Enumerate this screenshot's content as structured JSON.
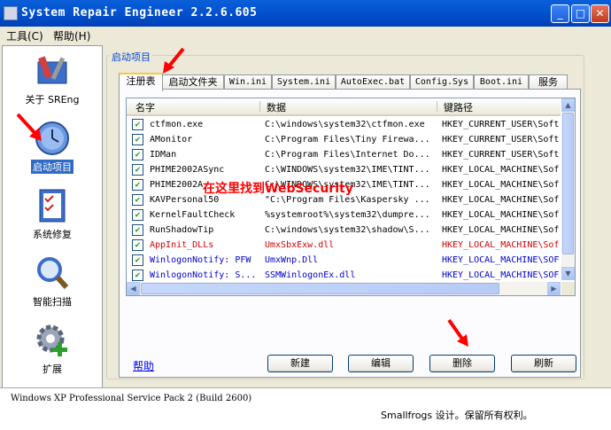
{
  "window": {
    "title": "System Repair Engineer 2.2.6.605",
    "minimize": "_",
    "maximize": "□",
    "close": "✕"
  },
  "menu": [
    "工具(C)",
    "帮助(H)"
  ],
  "sidebar": [
    {
      "label": "关于 SREng",
      "icon": "toolbox-icon",
      "selected": false
    },
    {
      "label": "启动项目",
      "icon": "clock-icon",
      "selected": true
    },
    {
      "label": "系统修复",
      "icon": "checklist-icon",
      "selected": false
    },
    {
      "label": "智能扫描",
      "icon": "magnifier-icon",
      "selected": false
    },
    {
      "label": "扩展",
      "icon": "gear-plus-icon",
      "selected": false
    }
  ],
  "group_title": "启动项目",
  "tabs": [
    "注册表",
    "启动文件夹",
    "Win.ini",
    "System.ini",
    "AutoExec.bat",
    "Config.Sys",
    "Boot.ini",
    "服务"
  ],
  "columns": [
    "名字",
    "数据",
    "键路径"
  ],
  "rows": [
    {
      "name": "ctfmon.exe",
      "data": "C:\\windows\\system32\\ctfmon.exe",
      "key": "HKEY_CURRENT_USER\\Soft",
      "color": "black"
    },
    {
      "name": "AMonitor",
      "data": "C:\\Program Files\\Tiny Firewa...",
      "key": "HKEY_CURRENT_USER\\Soft",
      "color": "black"
    },
    {
      "name": "IDMan",
      "data": "C:\\Program Files\\Internet Do...",
      "key": "HKEY_CURRENT_USER\\Soft",
      "color": "black"
    },
    {
      "name": "PHIME2002ASync",
      "data": "C:\\WINDOWS\\system32\\IME\\TINT...",
      "key": "HKEY_LOCAL_MACHINE\\Sof",
      "color": "black"
    },
    {
      "name": "PHIME2002A",
      "data": "C:\\WINDOWS\\system32\\IME\\TINT...",
      "key": "HKEY_LOCAL_MACHINE\\Sof",
      "color": "black"
    },
    {
      "name": "KAVPersonal50",
      "data": "\"C:\\Program Files\\Kaspersky ...",
      "key": "HKEY_LOCAL_MACHINE\\Sof",
      "color": "black"
    },
    {
      "name": "KernelFaultCheck",
      "data": "%systemroot%\\system32\\dumpre...",
      "key": "HKEY_LOCAL_MACHINE\\Sof",
      "color": "black"
    },
    {
      "name": "RunShadowTip",
      "data": "C:\\windows\\system32\\shadow\\S...",
      "key": "HKEY_LOCAL_MACHINE\\Sof",
      "color": "black"
    },
    {
      "name": "AppInit_DLLs",
      "data": "UmxSbxExw.dll",
      "key": "HKEY_LOCAL_MACHINE\\Sof",
      "color": "red"
    },
    {
      "name": "WinlogonNotify: PFW",
      "data": "UmxWnp.Dll",
      "key": "HKEY_LOCAL_MACHINE\\SOF",
      "color": "blue"
    },
    {
      "name": "WinlogonNotify: S...",
      "data": "SSMWinlogonEx.dll",
      "key": "HKEY_LOCAL_MACHINE\\SOF",
      "color": "blue"
    }
  ],
  "annotation": "在这里找到WebSecurity",
  "help_link": "帮助",
  "buttons": [
    "新建",
    "编辑",
    "删除",
    "刷新"
  ],
  "status": {
    "os": "Windows XP Professional Service Pack 2 (Build 2600)",
    "copyright": "Smallfrogs 设计。保留所有权利。"
  },
  "colors": {
    "titlebar": "#0354d1",
    "selection": "#316ac5",
    "annotation": "#ff0000",
    "red_row": "#d40000",
    "blue_row": "#0000cc"
  }
}
